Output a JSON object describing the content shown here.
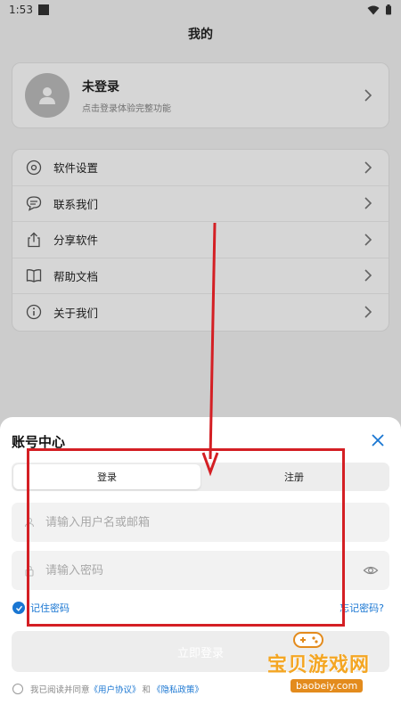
{
  "status_bar": {
    "time": "1:53"
  },
  "page": {
    "title": "我的"
  },
  "profile": {
    "name": "未登录",
    "subtitle": "点击登录体验完整功能"
  },
  "menu": {
    "items": [
      {
        "label": "软件设置",
        "icon": "gear-icon"
      },
      {
        "label": "联系我们",
        "icon": "chat-bubble-icon"
      },
      {
        "label": "分享软件",
        "icon": "share-icon"
      },
      {
        "label": "帮助文档",
        "icon": "book-icon"
      },
      {
        "label": "关于我们",
        "icon": "info-icon"
      }
    ]
  },
  "sheet": {
    "title": "账号中心",
    "tabs": {
      "login": "登录",
      "register": "注册"
    },
    "username_placeholder": "请输入用户名或邮箱",
    "password_placeholder": "请输入密码",
    "remember_label": "记住密码",
    "forgot_label": "忘记密码?",
    "login_button": "立即登录",
    "agree_prefix": "我已阅读并同意",
    "user_agreement": "《用户协议》",
    "and": "和",
    "privacy_policy": "《隐私政策》"
  },
  "watermark": {
    "title": "宝贝游戏网",
    "site": "baobeiy.com"
  },
  "colors": {
    "accent": "#1976d2",
    "annotation": "#d41f24",
    "watermark": "#f4a623"
  }
}
